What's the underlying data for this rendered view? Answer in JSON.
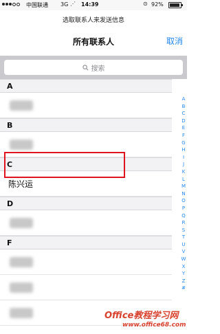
{
  "status": {
    "carrier": "中国联通",
    "network": "3G",
    "time": "14:39",
    "battery_pct": "92%",
    "battery_level": 0.92
  },
  "prompt": "选取联系人来发送信息",
  "nav": {
    "title": "所有联系人",
    "cancel": "取消"
  },
  "search": {
    "placeholder": "搜索"
  },
  "sections": [
    {
      "letter": "A"
    },
    {
      "letter": "B"
    },
    {
      "letter": "C",
      "contact": "陈兴运"
    },
    {
      "letter": "D"
    },
    {
      "letter": "F"
    }
  ],
  "index": [
    "A",
    "B",
    "C",
    "D",
    "E",
    "F",
    "G",
    "H",
    "I",
    "J",
    "K",
    "L",
    "M",
    "N",
    "O",
    "P",
    "Q",
    "R",
    "S",
    "T",
    "U",
    "V",
    "W",
    "X",
    "Y",
    "Z",
    "#"
  ],
  "watermark": {
    "line1": "Office教程学习网",
    "line2": "www.office68.com"
  },
  "colors": {
    "accent": "#1f86f0",
    "highlight": "#e0141e",
    "watermark": "#d9422f"
  }
}
